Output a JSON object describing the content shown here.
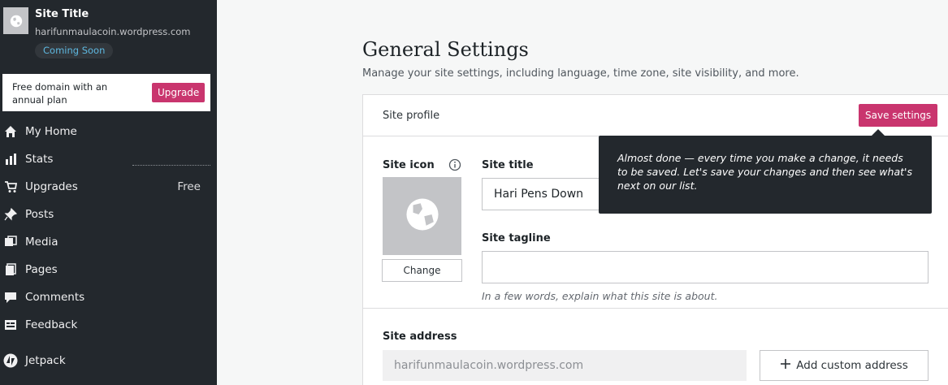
{
  "sidebar": {
    "site_name": "Site Title",
    "site_url": "harifunmaulacoin.wordpress.com",
    "status_badge": "Coming Soon",
    "upsell": {
      "text": "Free domain with an annual plan",
      "button": "Upgrade"
    },
    "nav": [
      {
        "label": "My Home",
        "icon": "home-icon"
      },
      {
        "label": "Stats",
        "icon": "stats-icon"
      },
      {
        "label": "Upgrades",
        "icon": "cart-icon",
        "extra": "Free"
      },
      {
        "label": "Posts",
        "icon": "pin-icon"
      },
      {
        "label": "Media",
        "icon": "media-icon"
      },
      {
        "label": "Pages",
        "icon": "pages-icon"
      },
      {
        "label": "Comments",
        "icon": "comments-icon"
      },
      {
        "label": "Feedback",
        "icon": "feedback-icon"
      },
      {
        "label": "Jetpack",
        "icon": "jetpack-icon"
      }
    ]
  },
  "main": {
    "title": "General Settings",
    "subtitle": "Manage your site settings, including language, time zone, site visibility, and more.",
    "card": {
      "header": "Site profile",
      "save_button": "Save settings",
      "site_icon_label": "Site icon",
      "change_button": "Change",
      "site_title_label": "Site title",
      "site_title_value": "Hari Pens Down",
      "site_tagline_label": "Site tagline",
      "site_tagline_value": "",
      "tagline_hint": "In a few words, explain what this site is about.",
      "site_address_label": "Site address",
      "site_address_value": "harifunmaulacoin.wordpress.com",
      "custom_address_button": "Add custom address"
    },
    "tooltip": "Almost done — every time you make a change, it needs to be saved. Let's save your changes and then see what's next on our list."
  },
  "colors": {
    "sidebar_bg": "#23282d",
    "accent_pink": "#c9356e",
    "badge_text": "#5eb8e0"
  }
}
